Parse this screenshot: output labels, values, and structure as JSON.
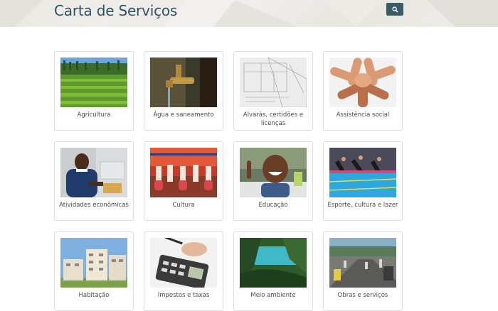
{
  "header": {
    "title": "Carta de Serviços",
    "search_icon": "search-icon",
    "accent": "#3a5c68",
    "title_color": "#2e5366"
  },
  "services": [
    {
      "label": "Agricultura",
      "image": "farm-field-image"
    },
    {
      "label": "Água e saneamento",
      "image": "water-tap-image"
    },
    {
      "label": "Alvarás, certidões e licenças",
      "image": "blueprint-image"
    },
    {
      "label": "Assistência social",
      "image": "joined-hands-image"
    },
    {
      "label": "Atividades econômicas",
      "image": "shop-worker-image"
    },
    {
      "label": "Cultura",
      "image": "folk-dance-image"
    },
    {
      "label": "Educação",
      "image": "smiling-child-image"
    },
    {
      "label": "Esporte, cultura e lazer",
      "image": "swimming-pool-image"
    },
    {
      "label": "Habitação",
      "image": "apartment-building-image"
    },
    {
      "label": "Impostos e taxas",
      "image": "calculator-image"
    },
    {
      "label": "Meio ambiente",
      "image": "bay-landscape-image"
    },
    {
      "label": "Obras e serviços",
      "image": "street-works-image"
    }
  ]
}
